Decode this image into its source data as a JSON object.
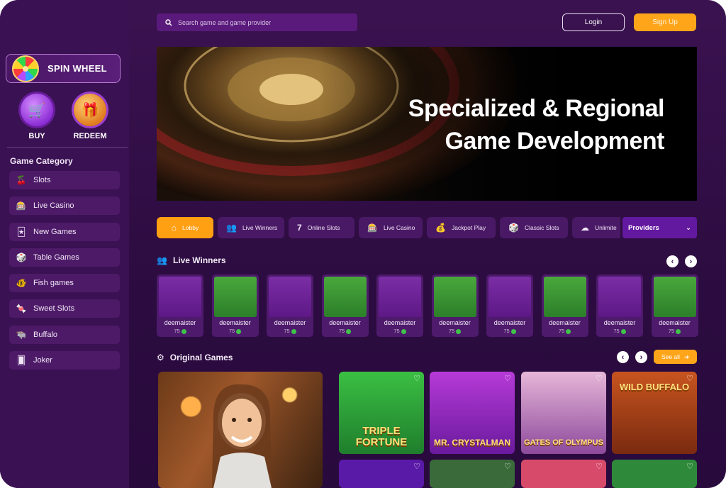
{
  "search": {
    "placeholder": "Search game and game provider"
  },
  "header": {
    "login_label": "Login",
    "signup_label": "Sign Up"
  },
  "sidebar": {
    "spin_label": "SPIN WHEEL",
    "buy_label": "BUY",
    "redeem_label": "REDEEM",
    "category_title": "Game Category",
    "categories": [
      {
        "label": "Slots",
        "icon": "cherry-icon"
      },
      {
        "label": "Live Casino",
        "icon": "dealer-icon"
      },
      {
        "label": "New Games",
        "icon": "cards-icon"
      },
      {
        "label": "Table Games",
        "icon": "chips-icon"
      },
      {
        "label": "Fish games",
        "icon": "fish-icon"
      },
      {
        "label": "Sweet Slots",
        "icon": "candy-icon"
      },
      {
        "label": "Buffalo",
        "icon": "buffalo-icon"
      },
      {
        "label": "Joker",
        "icon": "joker-icon"
      }
    ]
  },
  "hero": {
    "line1": "Specialized & Regional",
    "line2": "Game Development"
  },
  "tabs": [
    {
      "label": "Lobby",
      "icon": "home-icon",
      "active": true
    },
    {
      "label": "Live Winners",
      "icon": "winners-icon"
    },
    {
      "label": "Online Slots",
      "icon": "seven-icon"
    },
    {
      "label": "Live Casino",
      "icon": "slot-machine-icon"
    },
    {
      "label": "Jackpot Play",
      "icon": "jackpot-icon"
    },
    {
      "label": "Classic Slots",
      "icon": "dice-icon"
    },
    {
      "label": "Unlimite",
      "icon": "cloud-icon"
    }
  ],
  "providers": {
    "label": "Providers"
  },
  "live_winners": {
    "title": "Live Winners",
    "cards": [
      {
        "name": "deemaister",
        "amount": "75",
        "art": "queen"
      },
      {
        "name": "deemaister",
        "amount": "75",
        "art": "old"
      },
      {
        "name": "deemaister",
        "amount": "75",
        "art": "queen"
      },
      {
        "name": "deemaister",
        "amount": "75",
        "art": "old"
      },
      {
        "name": "deemaister",
        "amount": "75",
        "art": "queen"
      },
      {
        "name": "deemaister",
        "amount": "75",
        "art": "old"
      },
      {
        "name": "deemaister",
        "amount": "75",
        "art": "queen"
      },
      {
        "name": "deemaister",
        "amount": "75",
        "art": "old"
      },
      {
        "name": "deemaister",
        "amount": "75",
        "art": "queen"
      },
      {
        "name": "deemaister",
        "amount": "75",
        "art": "old"
      }
    ]
  },
  "original_games": {
    "title": "Original Games",
    "see_all_label": "See all",
    "games": [
      {
        "title": "TRIPLE FORTUNE"
      },
      {
        "title": "MR. CRYSTALMAN"
      },
      {
        "title": "GATES OF OLYMPUS"
      },
      {
        "title": "WILD BUFFALO"
      }
    ]
  },
  "colors": {
    "accent": "#ffa51a",
    "background": "#2c0c40",
    "sidebar": "#3a1152"
  }
}
